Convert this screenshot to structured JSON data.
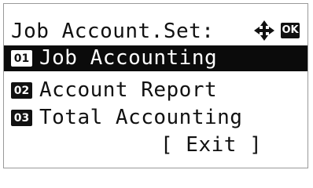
{
  "screen": {
    "title": "Job Account.Set:",
    "icons": {
      "nav": "four-way-arrow-icon",
      "ok": "OK"
    }
  },
  "menu": {
    "items": [
      {
        "number": "01",
        "label": "Job Accounting",
        "selected": true
      },
      {
        "number": "02",
        "label": "Account Report",
        "selected": false
      },
      {
        "number": "03",
        "label": "Total Accounting",
        "selected": false
      }
    ]
  },
  "exit": {
    "label": "[ Exit ]"
  }
}
